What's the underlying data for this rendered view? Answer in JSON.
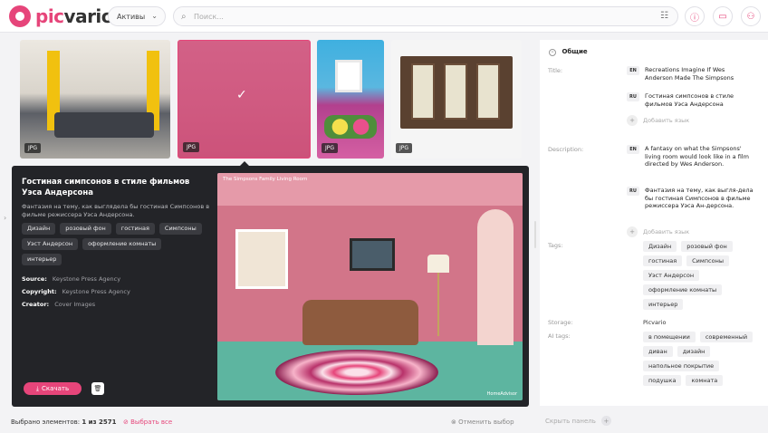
{
  "header": {
    "logo": "picvario",
    "assets_select": "Активы",
    "search_placeholder": "Поиск..."
  },
  "thumbnails": [
    {
      "badge": "JPG"
    },
    {
      "badge": "JPG",
      "selected": true
    },
    {
      "badge": "JPG"
    },
    {
      "badge": "JPG"
    }
  ],
  "detail": {
    "title": "Гостиная симпсонов в стиле фильмов Уэса Андерсона",
    "description": "Фантазия на тему, как выглядела бы гостиная Симпсонов в фильме режиссера Уэса Андерсона.",
    "tags": [
      "Дизайн",
      "розовый фон",
      "гостиная",
      "Симпсоны",
      "Уэст Андерсон",
      "оформление комнаты",
      "интерьер"
    ],
    "source_label": "Source:",
    "source": "Keystone Press Agency",
    "copyright_label": "Copyright:",
    "copyright": "Keystone Press Agency",
    "creator_label": "Creator:",
    "creator": "Cover Images",
    "download": "Скачать",
    "image_caption": "The Simpsons Family Living Room",
    "image_brand": "HomeAdvisor"
  },
  "rpanel": {
    "section": "Общие",
    "title_label": "Title:",
    "title_en_code": "EN",
    "title_en": "Recreations Imagine If Wes Anderson Made The Simpsons",
    "title_ru_code": "RU",
    "title_ru": "Гостиная симпсонов в стиле фильмов Уэса Андерсона",
    "add_lang": "Добавить язык",
    "desc_label": "Description:",
    "desc_en_code": "EN",
    "desc_en": "A fantasy on what the Simpsons' living room would look like in a film directed by Wes Anderson.",
    "desc_ru_code": "RU",
    "desc_ru": "Фантазия на тему, как выгля-дела бы гостиная Симпсонов в фильме режиссера Уэса Ан-дерсона.",
    "add_lang2": "Добавить язык",
    "tags_label": "Tags:",
    "tags": [
      "Дизайн",
      "розовый фон",
      "гостиная",
      "Симпсоны",
      "Уэст Андерсон",
      "оформление комнаты",
      "интерьер"
    ],
    "storage_label": "Storage:",
    "storage": "Picvario",
    "ai_label": "AI tags:",
    "ai_tags": [
      "в помещении",
      "современный",
      "диван",
      "дизайн",
      "напольное покрытие",
      "подушка",
      "комната"
    ]
  },
  "footer": {
    "selected_prefix": "Выбрано элементов:",
    "selected_count": "1 из 2571",
    "select_all": "Выбрать все",
    "cancel": "Отменить выбор",
    "hide_panel": "Скрыть панель"
  },
  "colors": {
    "accent": "#e6457a",
    "dark_panel": "#232428"
  }
}
